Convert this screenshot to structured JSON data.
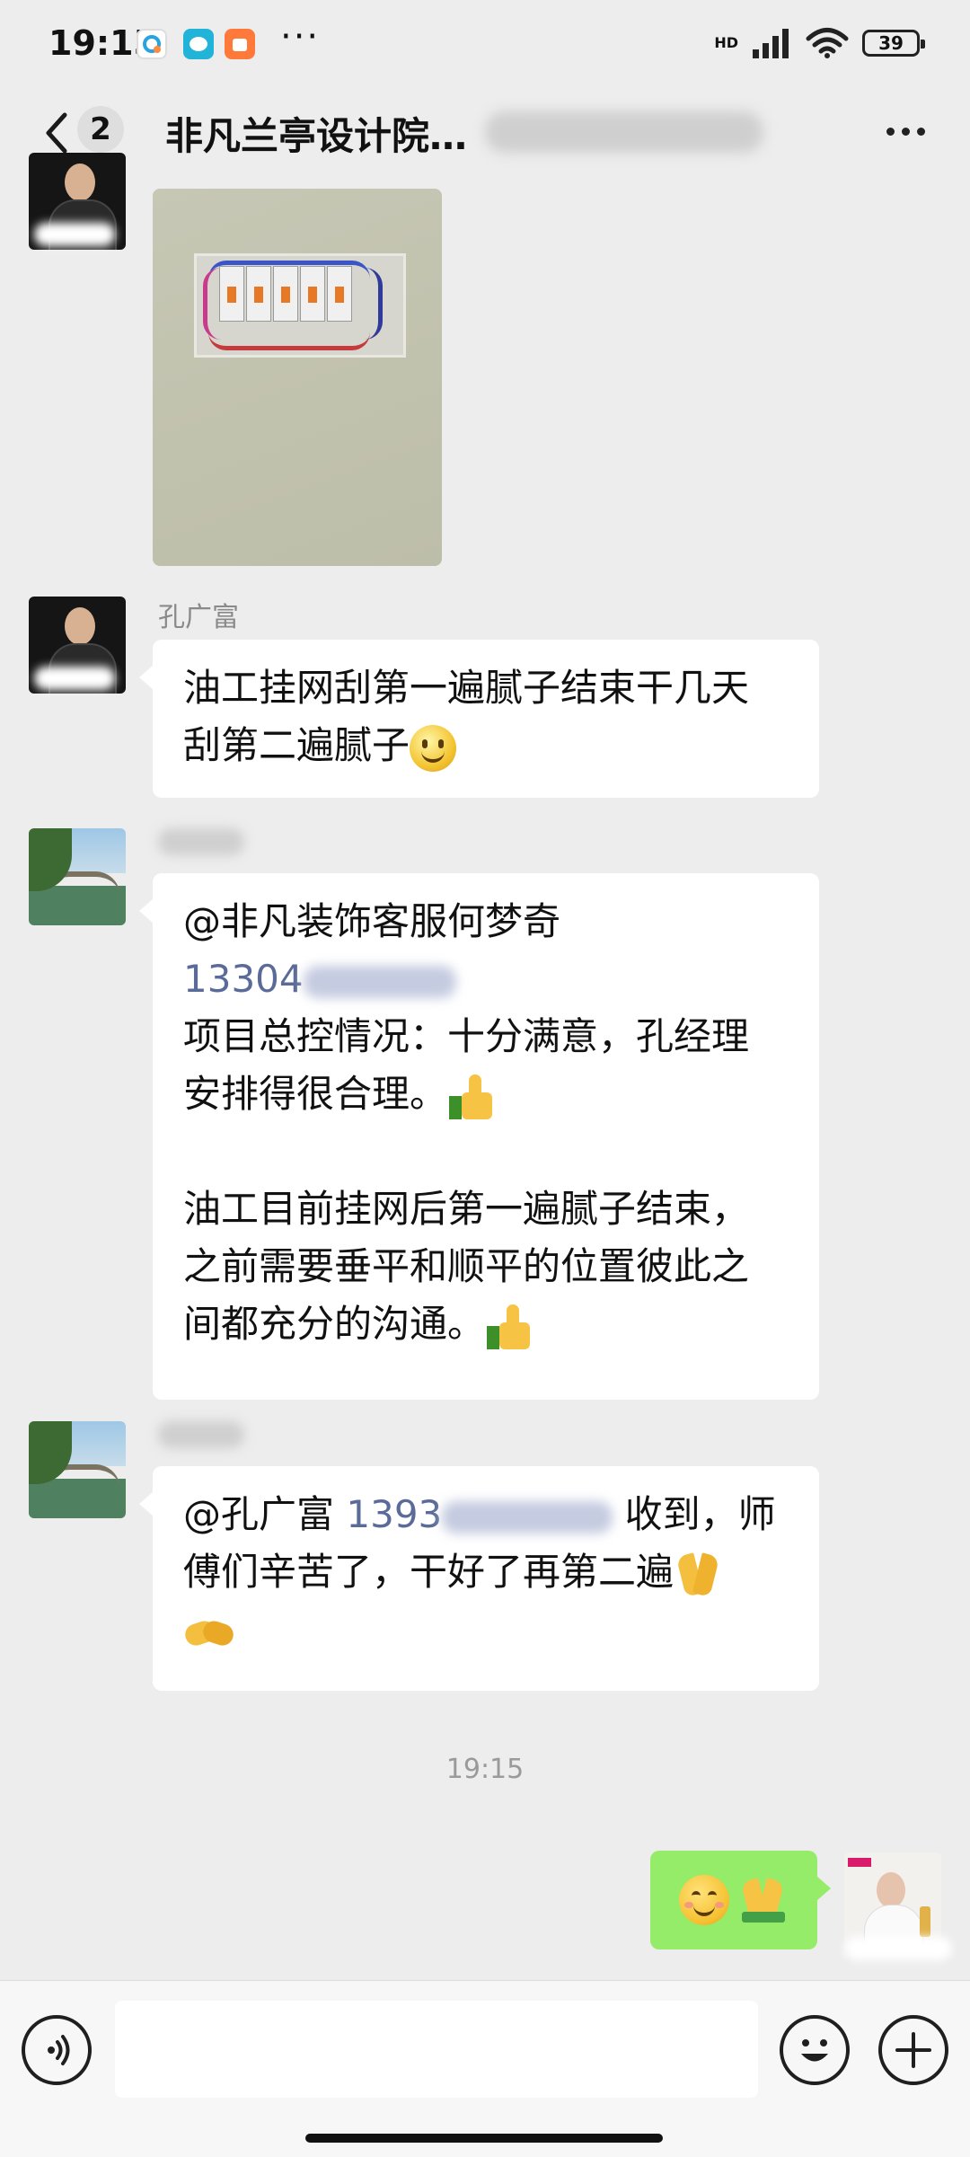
{
  "status_bar": {
    "time": "19:15",
    "network": "HD",
    "battery": "39",
    "more": "···"
  },
  "header": {
    "back_badge": "2",
    "title": "非凡兰亭设计院…"
  },
  "messages": [
    {
      "type": "image",
      "sender_side": "left",
      "alt": "electrical breaker box photo"
    },
    {
      "type": "text",
      "sender_side": "left",
      "sender_name": "孔广富",
      "lines": [
        "油工挂网刮第一遍腻子结束干几天",
        "刮第二遍腻子"
      ]
    },
    {
      "type": "text",
      "sender_side": "left",
      "sender_name": "",
      "mention": "@非凡装饰客服何梦奇",
      "phone": "13304",
      "lines": [
        "项目总控情况：十分满意，孔经理",
        "安排得很合理。",
        "",
        "油工目前挂网后第一遍腻子结束，",
        "之前需要垂平和顺平的位置彼此之",
        "间都充分的沟通。"
      ]
    },
    {
      "type": "text",
      "sender_side": "left",
      "sender_name": "",
      "mention": "@孔广富",
      "phone": "1393",
      "tail": "收到，师",
      "lines": [
        "傅们辛苦了，干好了再第二遍"
      ]
    }
  ],
  "timestamp": "19:15",
  "icons": {
    "back": "chevron-left-icon",
    "menu": "more-dots-icon",
    "voice": "voice-icon",
    "emoji": "emoji-icon",
    "plus": "plus-icon"
  },
  "colors": {
    "background": "#ededed",
    "outgoing_bubble": "#95ec69",
    "incoming_bubble": "#ffffff",
    "phone_link": "#5b6b99"
  }
}
